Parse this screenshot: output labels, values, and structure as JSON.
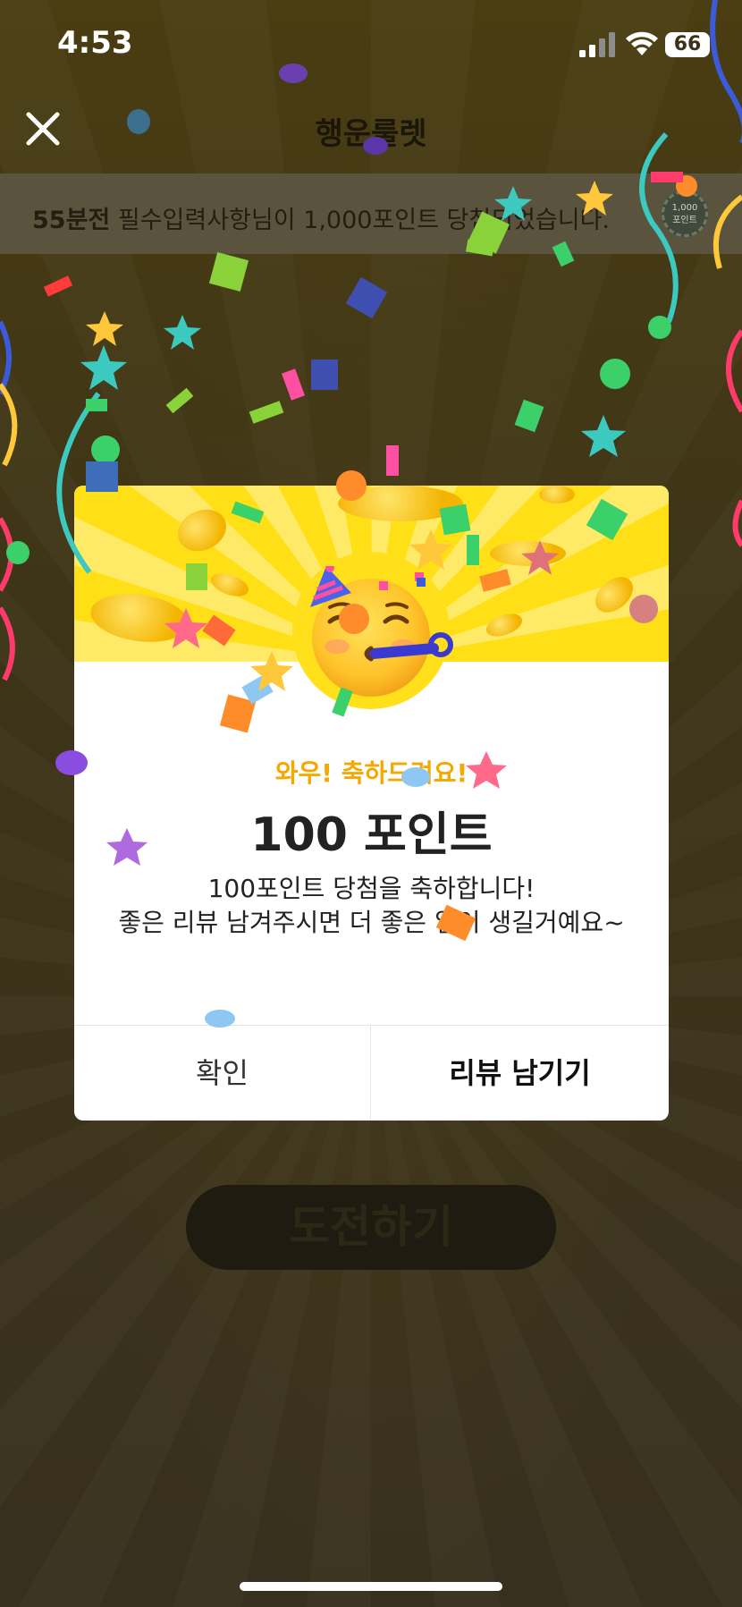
{
  "status_bar": {
    "time": "4:53",
    "battery": "66"
  },
  "header": {
    "title": "행운룰렛"
  },
  "ticker": {
    "time_ago": "55분전",
    "message": "필수입력사항님이 1,000포인트 당첨되었습니다.",
    "badge_amount": "1,000",
    "badge_unit": "포인트"
  },
  "challenge_button": {
    "label": "도전하기"
  },
  "modal": {
    "subtitle": "와우! 축하드려요!",
    "title": "100 포인트",
    "message_line1": "100포인트 당첨을 축하합니다!",
    "message_line2": "좋은 리뷰 남겨주시면 더 좋은 일이 생길거예요~",
    "confirm_label": "확인",
    "review_label": "리뷰 남기기"
  },
  "colors": {
    "accent": "#f6a700",
    "hero_yellow": "#ffdf15",
    "backdrop": "#3b3219"
  }
}
